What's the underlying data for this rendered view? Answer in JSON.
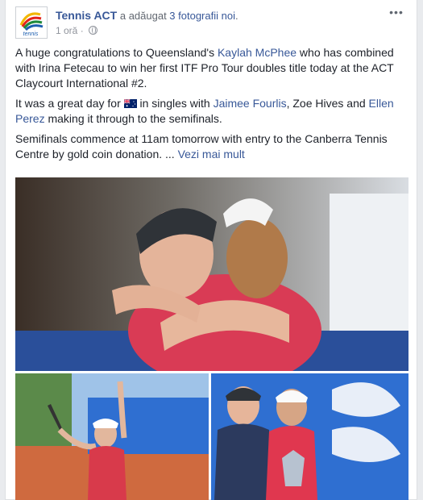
{
  "post": {
    "page_name": "Tennis ACT",
    "action_text": " a adăugat ",
    "action_link": "3 fotografii noi",
    "action_end": ".",
    "time": "1 oră",
    "time_sep": " · ",
    "menu_label": "•••",
    "avatar_logo_text": "tennis",
    "p1": {
      "before": "A huge congratulations to Queensland's ",
      "link": "Kaylah McPhee",
      "after": " who has combined with Irina Fetecau to win her first ITF Pro Tour doubles title today at the ACT Claycourt International #2."
    },
    "p2": {
      "before": "It was a great day for ",
      "middle": " in singles with ",
      "link1": "Jaimee Fourlis",
      "sep": ", Zoe Hives and ",
      "link2": "Ellen Perez",
      "after": " making it through to the semifinals."
    },
    "p3": {
      "before": "Semifinals commence at 11am tomorrow with entry to the Canberra Tennis Centre by gold coin donation. ... ",
      "link": "Vezi mai mult"
    }
  },
  "colors": {
    "link": "#385898",
    "court_blue": "#2f6fd1",
    "shirt_red": "#d83a4b"
  }
}
